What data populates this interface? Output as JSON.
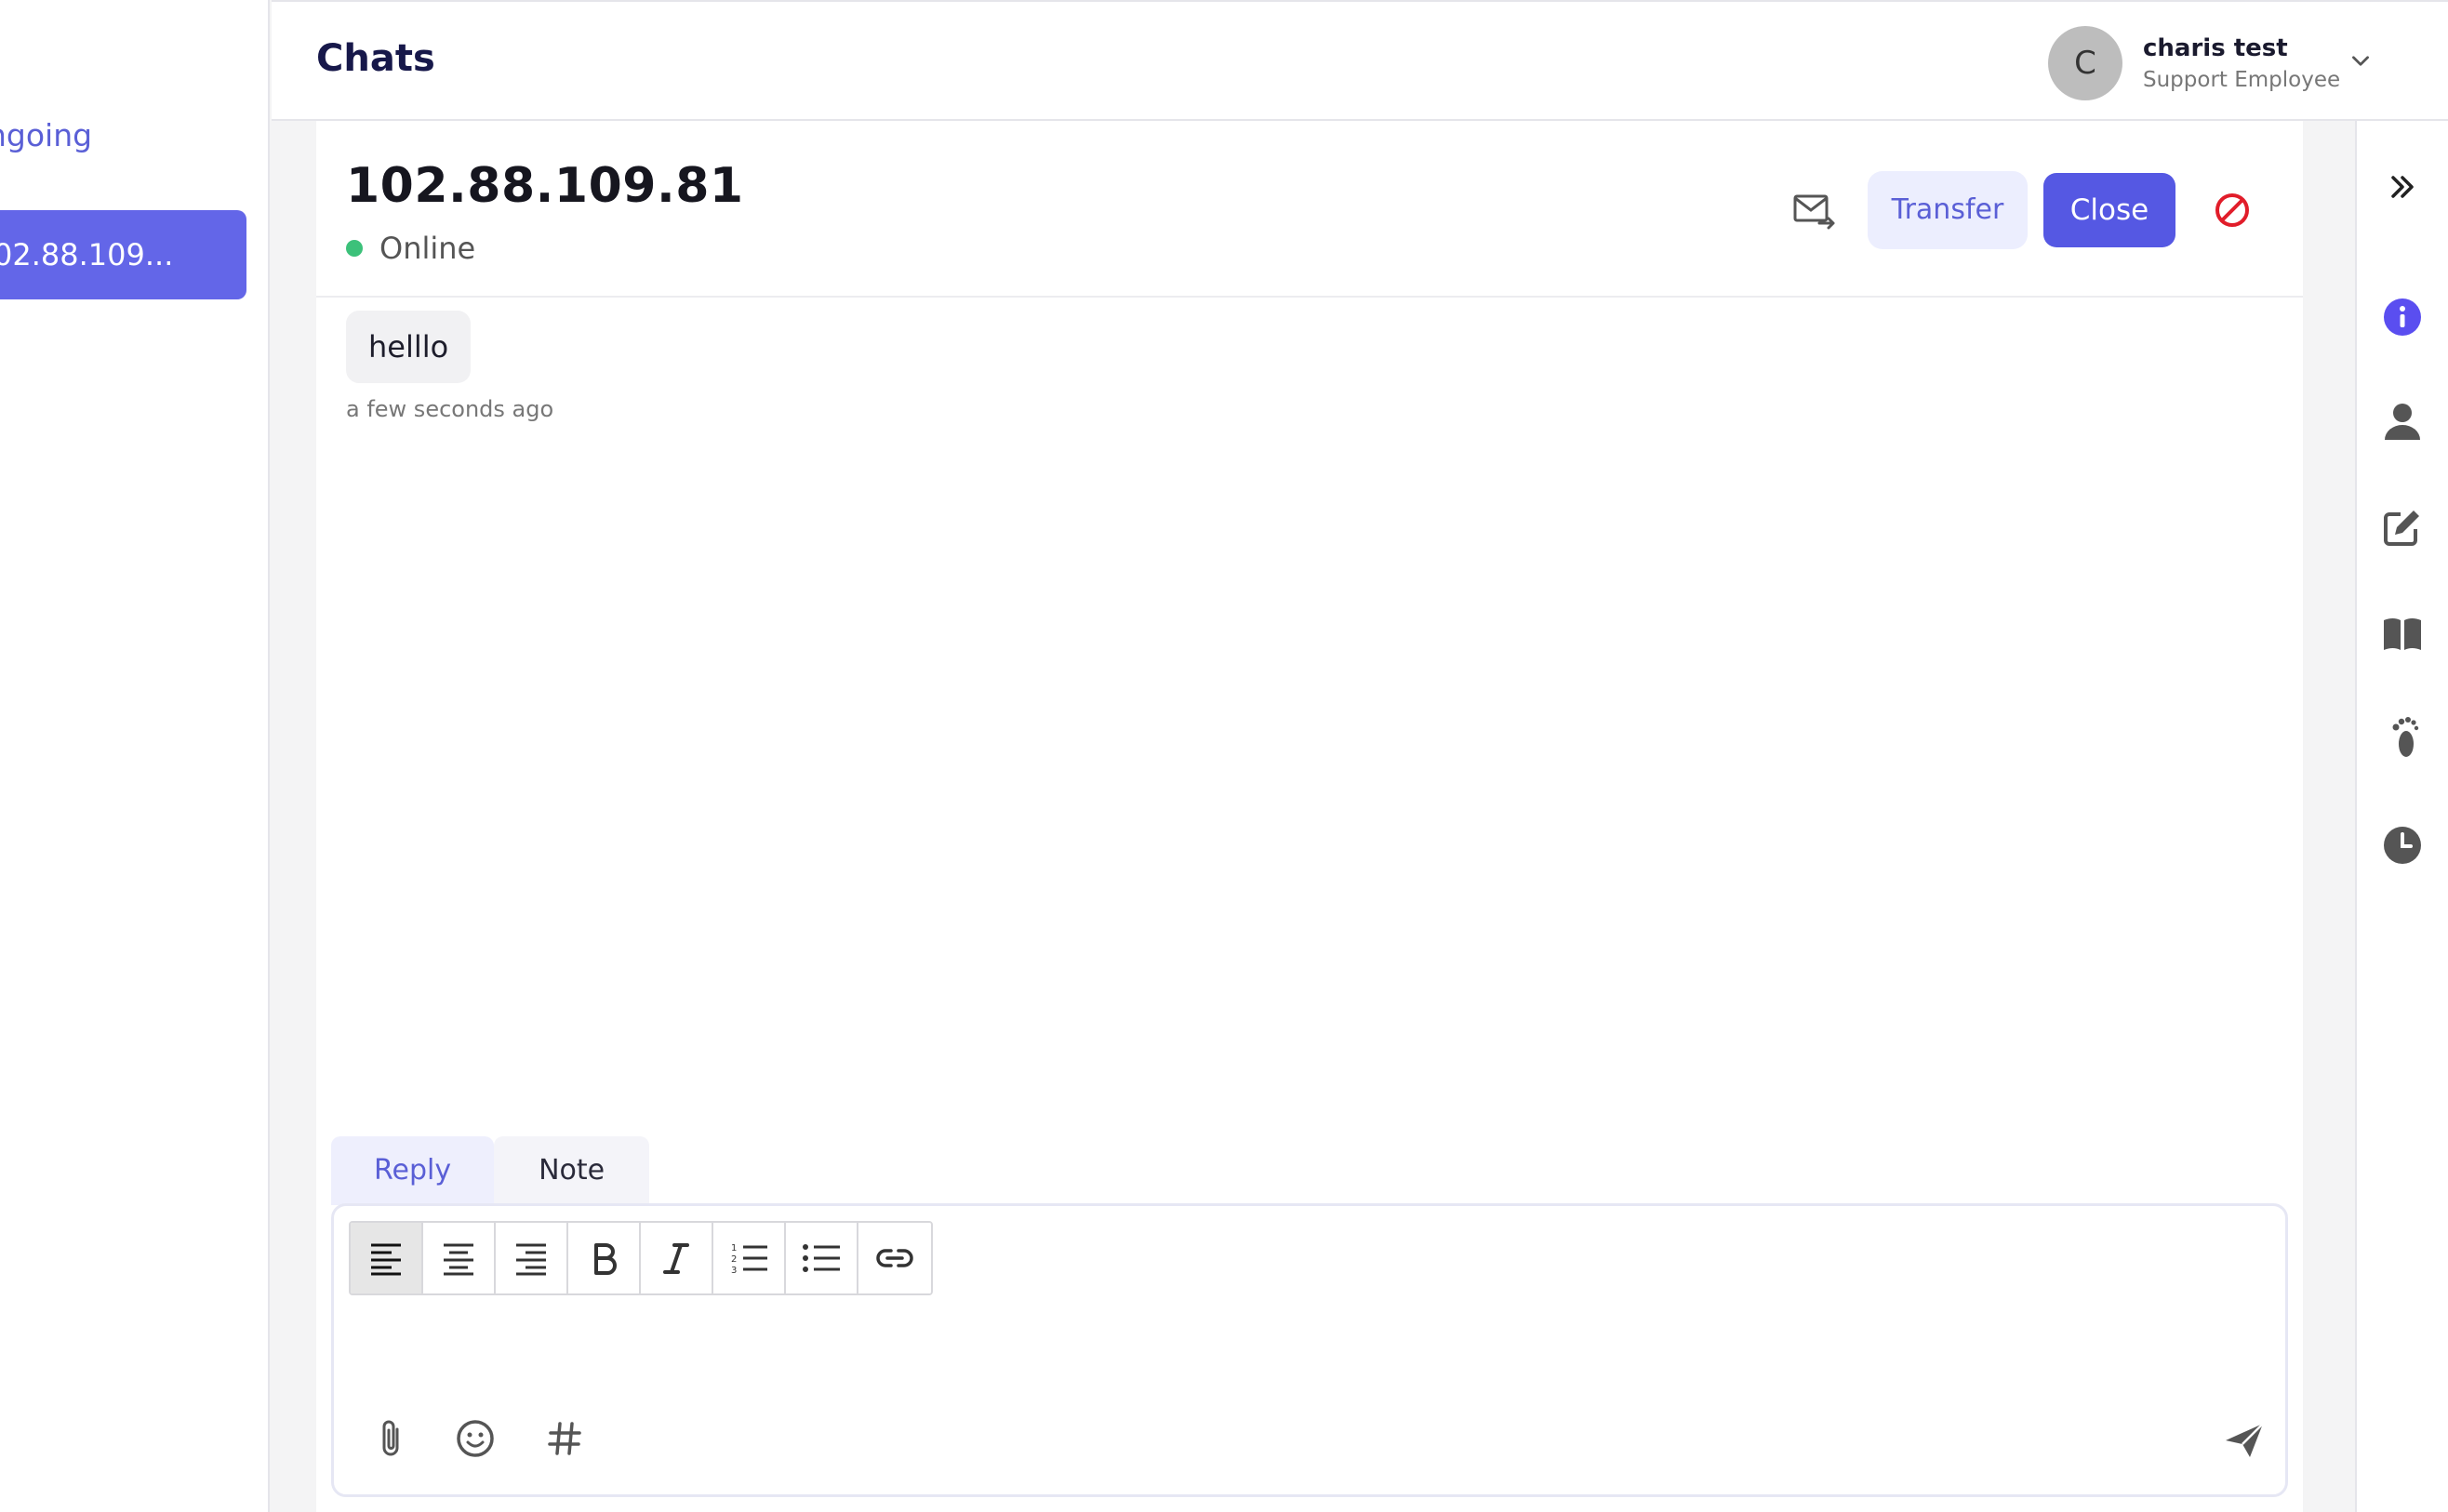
{
  "sidebar": {
    "section_label": "ngoing",
    "conversation_label": "02.88.109..."
  },
  "header": {
    "title": "Chats",
    "user": {
      "avatar_initial": "C",
      "name": "charis test",
      "role": "Support Employee"
    }
  },
  "chat": {
    "visitor_title": "102.88.109.81",
    "status": "Online",
    "actions": {
      "transcript_icon": "mail-forward-icon",
      "transfer_label": "Transfer",
      "close_label": "Close",
      "ban_icon": "ban-icon"
    },
    "messages": [
      {
        "text": "helllo",
        "time": "a few seconds ago"
      }
    ]
  },
  "composer": {
    "tabs": [
      "Reply",
      "Note"
    ],
    "active_tab": "Reply",
    "toolbar_icons": [
      "align-left-icon",
      "align-center-icon",
      "align-right-icon",
      "bold-icon",
      "italic-icon",
      "ordered-list-icon",
      "bullet-list-icon",
      "link-icon"
    ],
    "bottom_icons": [
      "paperclip-icon",
      "emoji-icon",
      "hashtag-icon",
      "send-icon"
    ]
  },
  "right_rail": {
    "icons": [
      "double-chevron-right-icon",
      "info-icon",
      "person-icon",
      "edit-icon",
      "book-icon",
      "footprints-icon",
      "clock-icon"
    ]
  },
  "colors": {
    "accent": "#5558e3",
    "accent_light": "#eceefe",
    "online": "#3cc17a",
    "danger": "#e11d2a"
  }
}
